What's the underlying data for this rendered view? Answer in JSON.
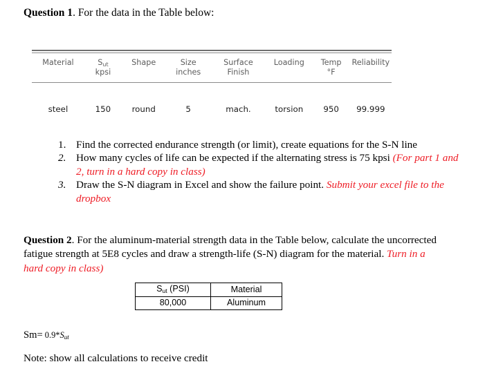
{
  "question1": {
    "label": "Question 1",
    "heading_rest": ". For the data in the Table below:",
    "table": {
      "headers": [
        {
          "line1": "Material",
          "sub": "",
          "line2": ""
        },
        {
          "line1": "S",
          "sub": "ut",
          "line2": "kpsi"
        },
        {
          "line1": "Shape",
          "sub": "",
          "line2": ""
        },
        {
          "line1": "Size",
          "sub": "",
          "line2": "inches"
        },
        {
          "line1": "Surface",
          "sub": "",
          "line2": "Finish"
        },
        {
          "line1": "Loading",
          "sub": "",
          "line2": ""
        },
        {
          "line1": "Temp",
          "sub": "",
          "line2": "°F"
        },
        {
          "line1": "Reliability",
          "sub": "",
          "line2": ""
        }
      ],
      "rows": [
        {
          "material": "steel",
          "sut_kpsi": "150",
          "shape": "round",
          "size_inches": "5",
          "surface_finish": "mach.",
          "loading": "torsion",
          "temp_f": "950",
          "reliability": "99.999"
        }
      ]
    },
    "tasks": [
      {
        "marker": "1.",
        "marker_italic": false,
        "black_text": "Find the corrected endurance strength (or limit), create equations for the S-N line",
        "red_text": ""
      },
      {
        "marker": "2.",
        "marker_italic": true,
        "black_text": "How many cycles of life can be expected if the alternating stress is 75 kpsi ",
        "red_text": "(For part 1 and 2, turn in a hard copy in class)"
      },
      {
        "marker": "3.",
        "marker_italic": true,
        "black_text": "Draw the S-N diagram in Excel and show the failure point. ",
        "red_text": "Submit your excel file to the dropbox"
      }
    ]
  },
  "question2": {
    "label": "Question 2",
    "black_text": ". For the aluminum-material strength data in the Table below, calculate the uncorrected fatigue strength at 5E8 cycles and draw a strength-life (S-N) diagram for the material. ",
    "red_text": "Turn in a hard copy in class)",
    "mini_table": {
      "headers": [
        {
          "text_main": "S",
          "text_sub": "ut",
          "text_tail": " (PSI)"
        },
        {
          "text_main": "Material",
          "text_sub": "",
          "text_tail": ""
        }
      ],
      "row": {
        "sut_psi": "80,000",
        "material": "Aluminum"
      }
    }
  },
  "footer": {
    "sm_formula": {
      "lead": "Sm=",
      "value": " 0.9*",
      "sym_main": "S",
      "sym_sub": "ut"
    },
    "note": "Note: show all calculations to receive credit"
  },
  "colors": {
    "red_accent": "#ee1c25",
    "rule_gray": "#8a8a8a",
    "header_text": "#5d5d5d"
  }
}
